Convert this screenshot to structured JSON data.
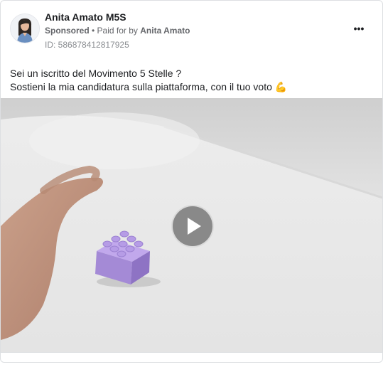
{
  "post": {
    "page_name": "Anita Amato M5S",
    "sponsored_label": "Sponsored",
    "separator": " • ",
    "paid_for_prefix": "Paid for by ",
    "paid_for_name": "Anita Amato",
    "ad_id": "ID: 586878412817925",
    "more_label": "•••",
    "text_line1": "Sei un iscritto del Movimento 5 Stelle ?",
    "text_line2": "Sostieni la mia candidatura sulla piattaforma, con il tuo voto ",
    "emoji": "💪"
  },
  "colors": {
    "text_primary": "#1c1e21",
    "text_secondary": "#65676b",
    "brick": "#a88ad8",
    "play_button": "#787878"
  },
  "icons": [
    "avatar",
    "more-options-icon",
    "flexed-biceps-emoji",
    "play-icon"
  ]
}
